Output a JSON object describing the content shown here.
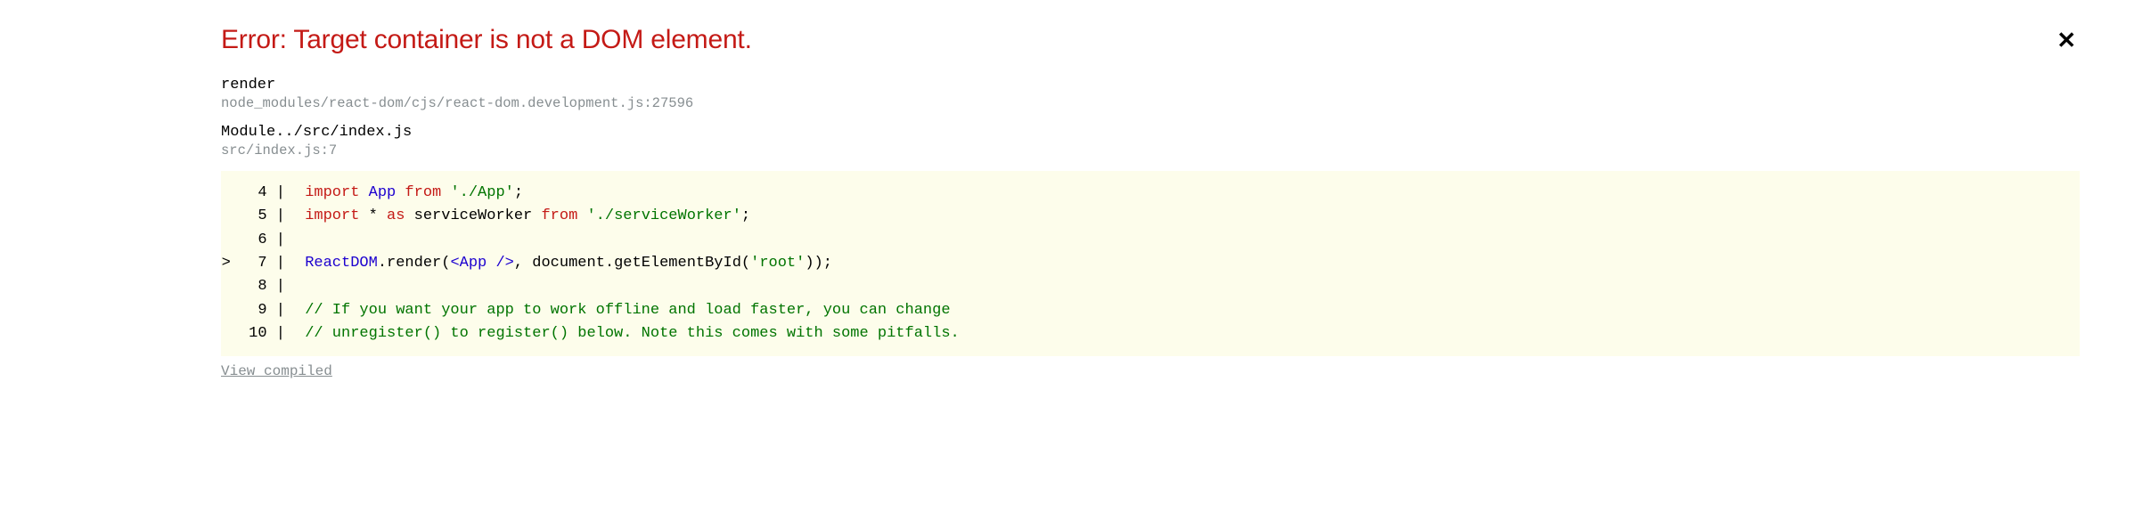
{
  "error_title": "Error: Target container is not a DOM element.",
  "frames": [
    {
      "name": "render",
      "path": "node_modules/react-dom/cjs/react-dom.development.js:27596"
    },
    {
      "name": "Module../src/index.js",
      "path": "src/index.js:7"
    }
  ],
  "code": {
    "highlighted_line": 7,
    "lines": [
      {
        "num": 4,
        "tokens": [
          {
            "t": "import ",
            "c": "keyword"
          },
          {
            "t": "App",
            "c": "ident"
          },
          {
            "t": " from ",
            "c": "keyword"
          },
          {
            "t": "'./App'",
            "c": "string"
          },
          {
            "t": ";",
            "c": "plain"
          }
        ]
      },
      {
        "num": 5,
        "tokens": [
          {
            "t": "import ",
            "c": "keyword"
          },
          {
            "t": "* ",
            "c": "plain"
          },
          {
            "t": "as ",
            "c": "keyword"
          },
          {
            "t": "serviceWorker ",
            "c": "plain"
          },
          {
            "t": "from ",
            "c": "keyword"
          },
          {
            "t": "'./serviceWorker'",
            "c": "string"
          },
          {
            "t": ";",
            "c": "plain"
          }
        ]
      },
      {
        "num": 6,
        "tokens": []
      },
      {
        "num": 7,
        "tokens": [
          {
            "t": "ReactDOM",
            "c": "ident"
          },
          {
            "t": ".render(",
            "c": "plain"
          },
          {
            "t": "<App />",
            "c": "ident"
          },
          {
            "t": ", document.getElementById(",
            "c": "plain"
          },
          {
            "t": "'root'",
            "c": "string"
          },
          {
            "t": "));",
            "c": "plain"
          }
        ]
      },
      {
        "num": 8,
        "tokens": []
      },
      {
        "num": 9,
        "tokens": [
          {
            "t": "// If you want your app to work offline and load faster, you can change",
            "c": "comment"
          }
        ]
      },
      {
        "num": 10,
        "tokens": [
          {
            "t": "// unregister() to register() below. Note this comes with some pitfalls.",
            "c": "comment"
          }
        ]
      }
    ]
  },
  "view_compiled_label": "View compiled"
}
